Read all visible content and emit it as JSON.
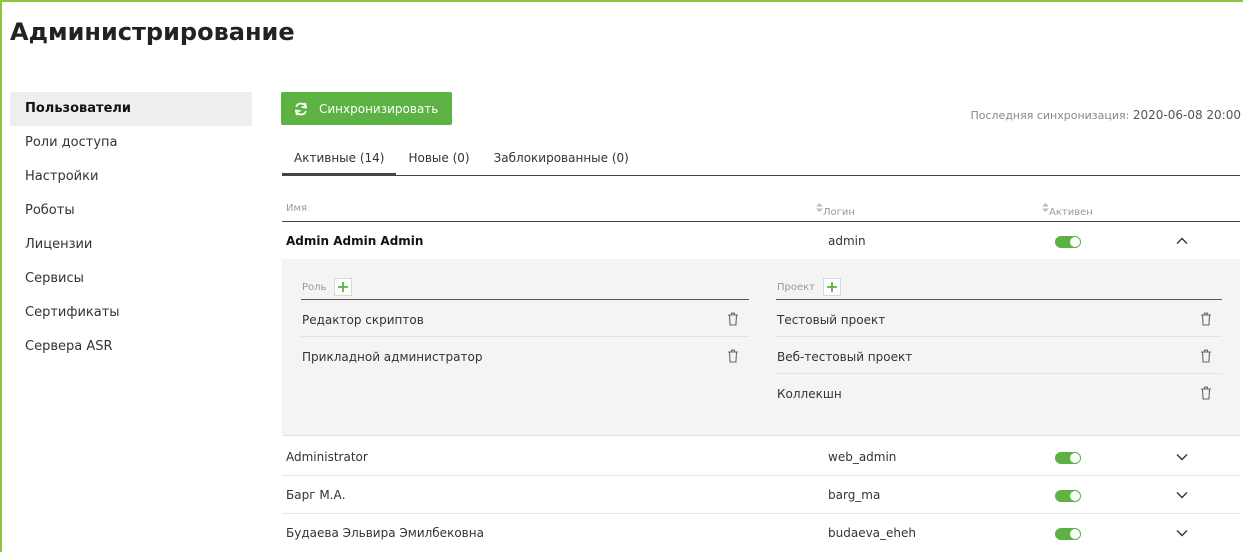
{
  "page": {
    "title": "Администрирование"
  },
  "sidebar": {
    "items": [
      {
        "label": "Пользователи"
      },
      {
        "label": "Роли доступа"
      },
      {
        "label": "Настройки"
      },
      {
        "label": "Роботы"
      },
      {
        "label": "Лицензии"
      },
      {
        "label": "Сервисы"
      },
      {
        "label": "Сертификаты"
      },
      {
        "label": "Сервера ASR"
      }
    ]
  },
  "toolbar": {
    "sync_label": "Синхронизировать",
    "last_sync_label": "Последняя синхронизация:",
    "last_sync_value": "2020-06-08 20:00"
  },
  "tabs": [
    {
      "label": "Активные (14)"
    },
    {
      "label": "Новые (0)"
    },
    {
      "label": "Заблокированные (0)"
    }
  ],
  "table": {
    "columns": {
      "name": "Имя",
      "login": "Логин",
      "active": "Активен"
    },
    "rows": [
      {
        "name": "Admin Admin Admin",
        "login": "admin",
        "active": true,
        "expanded": true
      },
      {
        "name": "Administrator",
        "login": "web_admin",
        "active": true,
        "expanded": false
      },
      {
        "name": "Барг М.А.",
        "login": "barg_ma",
        "active": true,
        "expanded": false
      },
      {
        "name": "Будаева Эльвира Эмилбековна",
        "login": "budaeva_eheh",
        "active": true,
        "expanded": false
      }
    ]
  },
  "details": {
    "roles_header": "Роль",
    "roles": [
      "Редактор скриптов",
      "Прикладной администратор"
    ],
    "projects_header": "Проект",
    "projects": [
      "Тестовый проект",
      "Веб-тестовый проект",
      "Коллекшн"
    ]
  },
  "colors": {
    "accent": "#5cb344",
    "frame": "#8cc63f"
  },
  "icons": {
    "sync": "sync-icon",
    "plus": "plus-icon",
    "trash": "trash-icon",
    "chevron_up": "chevron-up-icon",
    "chevron_down": "chevron-down-icon",
    "sort": "sort-icon"
  }
}
